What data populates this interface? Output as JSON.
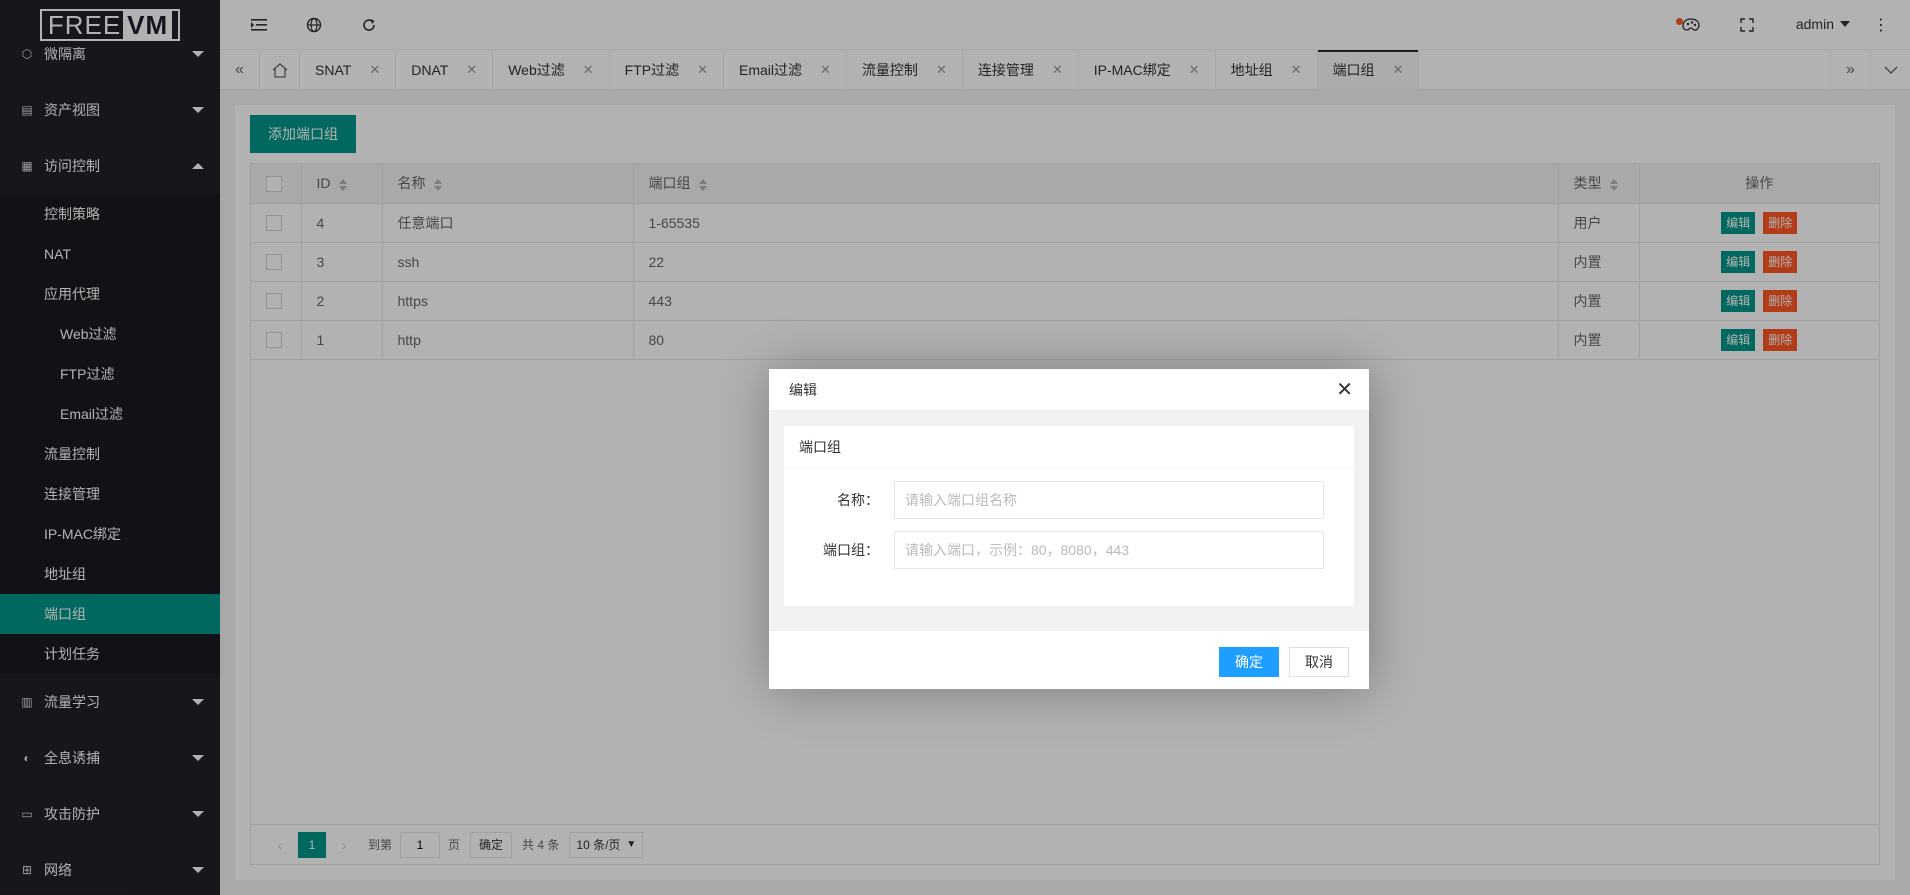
{
  "logo": {
    "part1": "FREE",
    "part2": "VM"
  },
  "sidebar": {
    "top_items": [
      {
        "label": "微隔离",
        "icon": "cube-icon"
      },
      {
        "label": "资产视图",
        "icon": "assets-icon"
      },
      {
        "label": "访问控制",
        "icon": "grid-icon"
      }
    ],
    "access_sub": {
      "control_policy": "控制策略",
      "nat": "NAT",
      "app_proxy": "应用代理",
      "app_proxy_items": [
        "Web过滤",
        "FTP过滤",
        "Email过滤"
      ],
      "flow_control": "流量控制",
      "conn_mgmt": "连接管理",
      "ip_mac": "IP-MAC绑定",
      "addr_group": "地址组",
      "port_group": "端口组",
      "schedule": "计划任务"
    },
    "bottom_items": [
      {
        "label": "流量学习",
        "icon": "learn-icon"
      },
      {
        "label": "全息诱捕",
        "icon": "trap-icon"
      },
      {
        "label": "攻击防护",
        "icon": "shield-icon"
      },
      {
        "label": "网络",
        "icon": "network-icon"
      }
    ]
  },
  "header": {
    "user": "admin"
  },
  "tabs": [
    "SNAT",
    "DNAT",
    "Web过滤",
    "FTP过滤",
    "Email过滤",
    "流量控制",
    "连接管理",
    "IP-MAC绑定",
    "地址组",
    "端口组"
  ],
  "toolbar": {
    "add_label": "添加端口组"
  },
  "table": {
    "headers": {
      "id": "ID",
      "name": "名称",
      "ports": "端口组",
      "type": "类型",
      "ops": "操作"
    },
    "rows": [
      {
        "id": "4",
        "name": "任意端口",
        "ports": "1-65535",
        "type": "用户"
      },
      {
        "id": "3",
        "name": "ssh",
        "ports": "22",
        "type": "内置"
      },
      {
        "id": "2",
        "name": "https",
        "ports": "443",
        "type": "内置"
      },
      {
        "id": "1",
        "name": "http",
        "ports": "80",
        "type": "内置"
      }
    ],
    "edit_label": "编辑",
    "delete_label": "删除"
  },
  "pager": {
    "current": "1",
    "goto_label": "到第",
    "goto_value": "1",
    "page_label": "页",
    "confirm_label": "确定",
    "total_label": "共 4 条",
    "limit_label": "10 条/页"
  },
  "modal": {
    "title": "编辑",
    "section_title": "端口组",
    "name_label": "名称：",
    "name_placeholder": "请输入端口组名称",
    "ports_label": "端口组：",
    "ports_placeholder": "请输入端口，示例：80，8080，443",
    "ok_label": "确定",
    "cancel_label": "取消"
  }
}
